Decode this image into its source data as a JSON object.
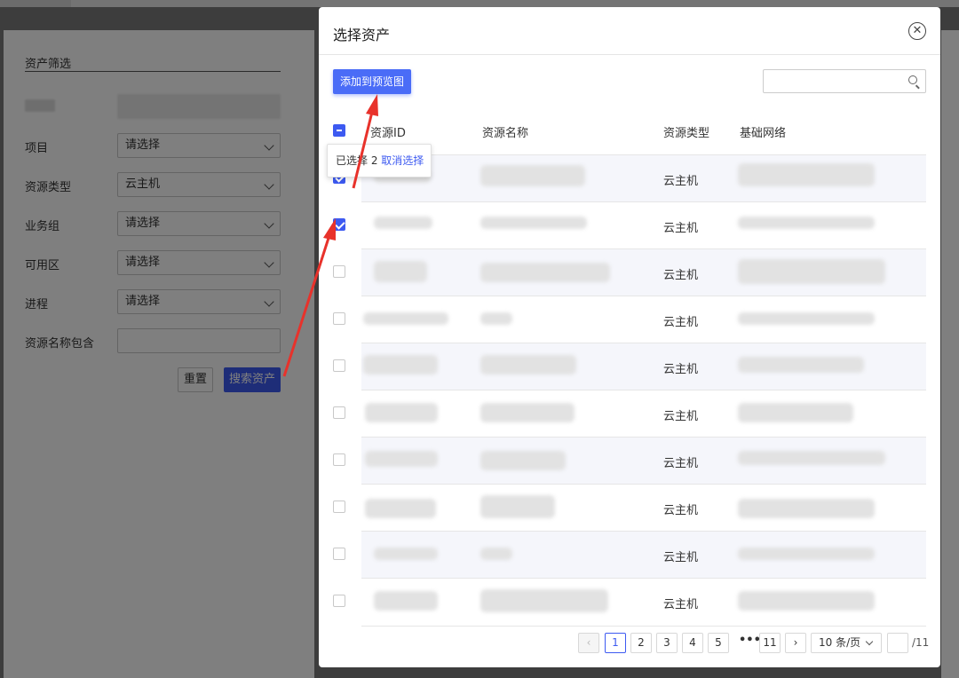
{
  "background_page": {
    "filter_title": "资产筛选",
    "fields": [
      {
        "label": "项目",
        "value": "请选择"
      },
      {
        "label": "资源类型",
        "value": "云主机"
      },
      {
        "label": "业务组",
        "value": "请选择"
      },
      {
        "label": "可用区",
        "value": "请选择"
      },
      {
        "label": "进程",
        "value": "请选择"
      }
    ],
    "name_contains_label": "资源名称包含",
    "reset_label": "重置",
    "search_label": "搜索资产"
  },
  "modal": {
    "title": "选择资产",
    "close_icon": "close-circle-icon",
    "add_button": "添加到预览图",
    "search_placeholder": "",
    "columns": [
      "资源ID",
      "资源名称",
      "资源类型",
      "基础网络"
    ],
    "selection_tooltip": {
      "text": "已选择 2",
      "action": "取消选择"
    },
    "rows": [
      {
        "type": "云主机",
        "checked": true
      },
      {
        "type": "云主机",
        "checked": true
      },
      {
        "type": "云主机",
        "checked": false
      },
      {
        "type": "云主机",
        "checked": false
      },
      {
        "type": "云主机",
        "checked": false
      },
      {
        "type": "云主机",
        "checked": false
      },
      {
        "type": "云主机",
        "checked": false
      },
      {
        "type": "云主机",
        "checked": false
      },
      {
        "type": "云主机",
        "checked": false
      },
      {
        "type": "云主机",
        "checked": false
      }
    ],
    "pagination": {
      "pages": [
        "1",
        "2",
        "3",
        "4",
        "5"
      ],
      "current": "1",
      "ellipsis": "•••",
      "last_page": "11",
      "page_size": "10 条/页",
      "total_pages": "/11"
    }
  },
  "colors": {
    "primary": "#3d5af1",
    "annotation": "#e8322b"
  }
}
